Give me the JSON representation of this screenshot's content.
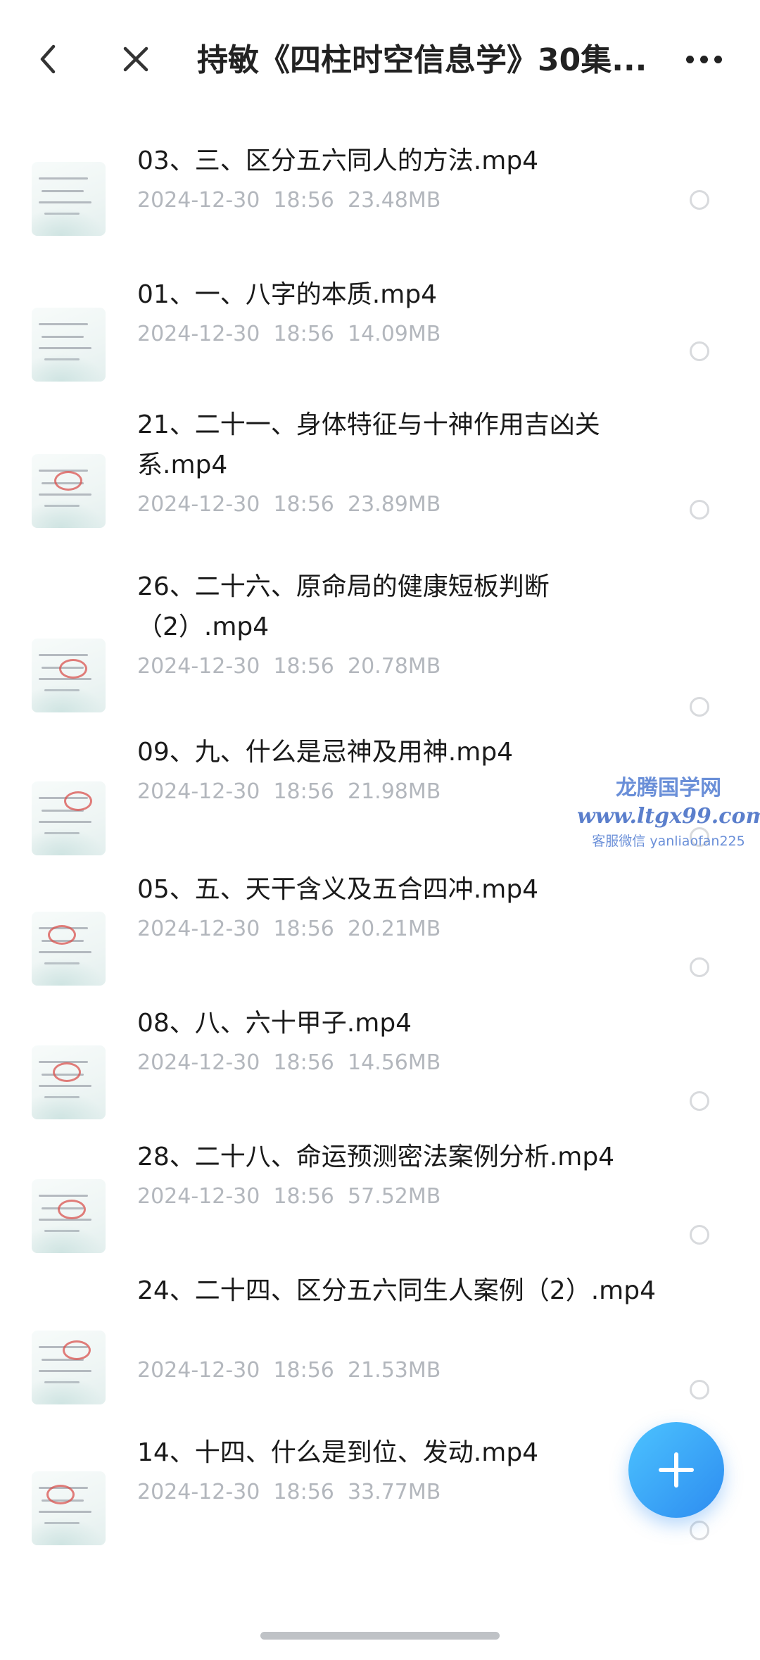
{
  "header": {
    "back_icon": "chevron-left-icon",
    "close_icon": "close-icon",
    "title": "持敏《四柱时空信息学》30集...",
    "more_icon": "more-horizontal-icon"
  },
  "files": [
    {
      "name": "03、三、区分五六同人的方法.mp4",
      "date": "2024-12-30",
      "time": "18:56",
      "size": "23.48MB"
    },
    {
      "name": "01、一、八字的本质.mp4",
      "date": "2024-12-30",
      "time": "18:56",
      "size": "14.09MB"
    },
    {
      "name": "21、二十一、身体特征与十神作用吉凶关系.mp4",
      "date": "2024-12-30",
      "time": "18:56",
      "size": "23.89MB"
    },
    {
      "name": "26、二十六、原命局的健康短板判断（2）.mp4",
      "date": "2024-12-30",
      "time": "18:56",
      "size": "20.78MB"
    },
    {
      "name": "09、九、什么是忌神及用神.mp4",
      "date": "2024-12-30",
      "time": "18:56",
      "size": "21.98MB"
    },
    {
      "name": "05、五、天干含义及五合四冲.mp4",
      "date": "2024-12-30",
      "time": "18:56",
      "size": "20.21MB"
    },
    {
      "name": "08、八、六十甲子.mp4",
      "date": "2024-12-30",
      "time": "18:56",
      "size": "14.56MB"
    },
    {
      "name": "28、二十八、命运预测密法案例分析.mp4",
      "date": "2024-12-30",
      "time": "18:56",
      "size": "57.52MB"
    },
    {
      "name": "24、二十四、区分五六同生人案例（2）.mp4",
      "date": "2024-12-30",
      "time": "18:56",
      "size": "21.53MB"
    },
    {
      "name": "14、十四、什么是到位、发动.mp4",
      "date": "2024-12-30",
      "time": "18:56",
      "size": "33.77MB"
    }
  ],
  "watermark": {
    "title": "龙腾国学网",
    "url": "www.ltgx99.com",
    "contact": "客服微信 yanliaofan225"
  },
  "fab": {
    "icon": "plus-icon"
  },
  "colors": {
    "accent": "#2d8cf0",
    "meta_text": "#b3b7bd",
    "watermark": "#6a8fd8"
  }
}
